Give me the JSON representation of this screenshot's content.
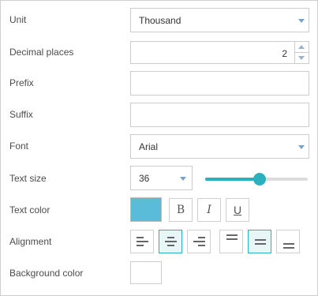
{
  "labels": {
    "unit": "Unit",
    "decimal_places": "Decimal places",
    "prefix": "Prefix",
    "suffix": "Suffix",
    "font": "Font",
    "text_size": "Text size",
    "text_color": "Text color",
    "alignment": "Alignment",
    "background_color": "Background color"
  },
  "unit": {
    "value": "Thousand"
  },
  "decimal_places": {
    "value": "2"
  },
  "prefix": {
    "value": ""
  },
  "suffix": {
    "value": ""
  },
  "font": {
    "value": "Arial"
  },
  "text_size": {
    "value": "36",
    "slider_fraction": 0.53
  },
  "text_color": {
    "color": "#5bbcd9"
  },
  "formatting": {
    "bold": "B",
    "italic": "I",
    "underline": "U"
  },
  "alignment": {
    "horizontal_options": [
      "left",
      "center",
      "right"
    ],
    "horizontal_selected": "center",
    "vertical_options": [
      "top",
      "middle",
      "bottom"
    ],
    "vertical_selected": "middle"
  },
  "background_color": {
    "color": "#ffffff"
  },
  "colors": {
    "accent": "#2bb0be",
    "caret": "#7aa1c5"
  }
}
